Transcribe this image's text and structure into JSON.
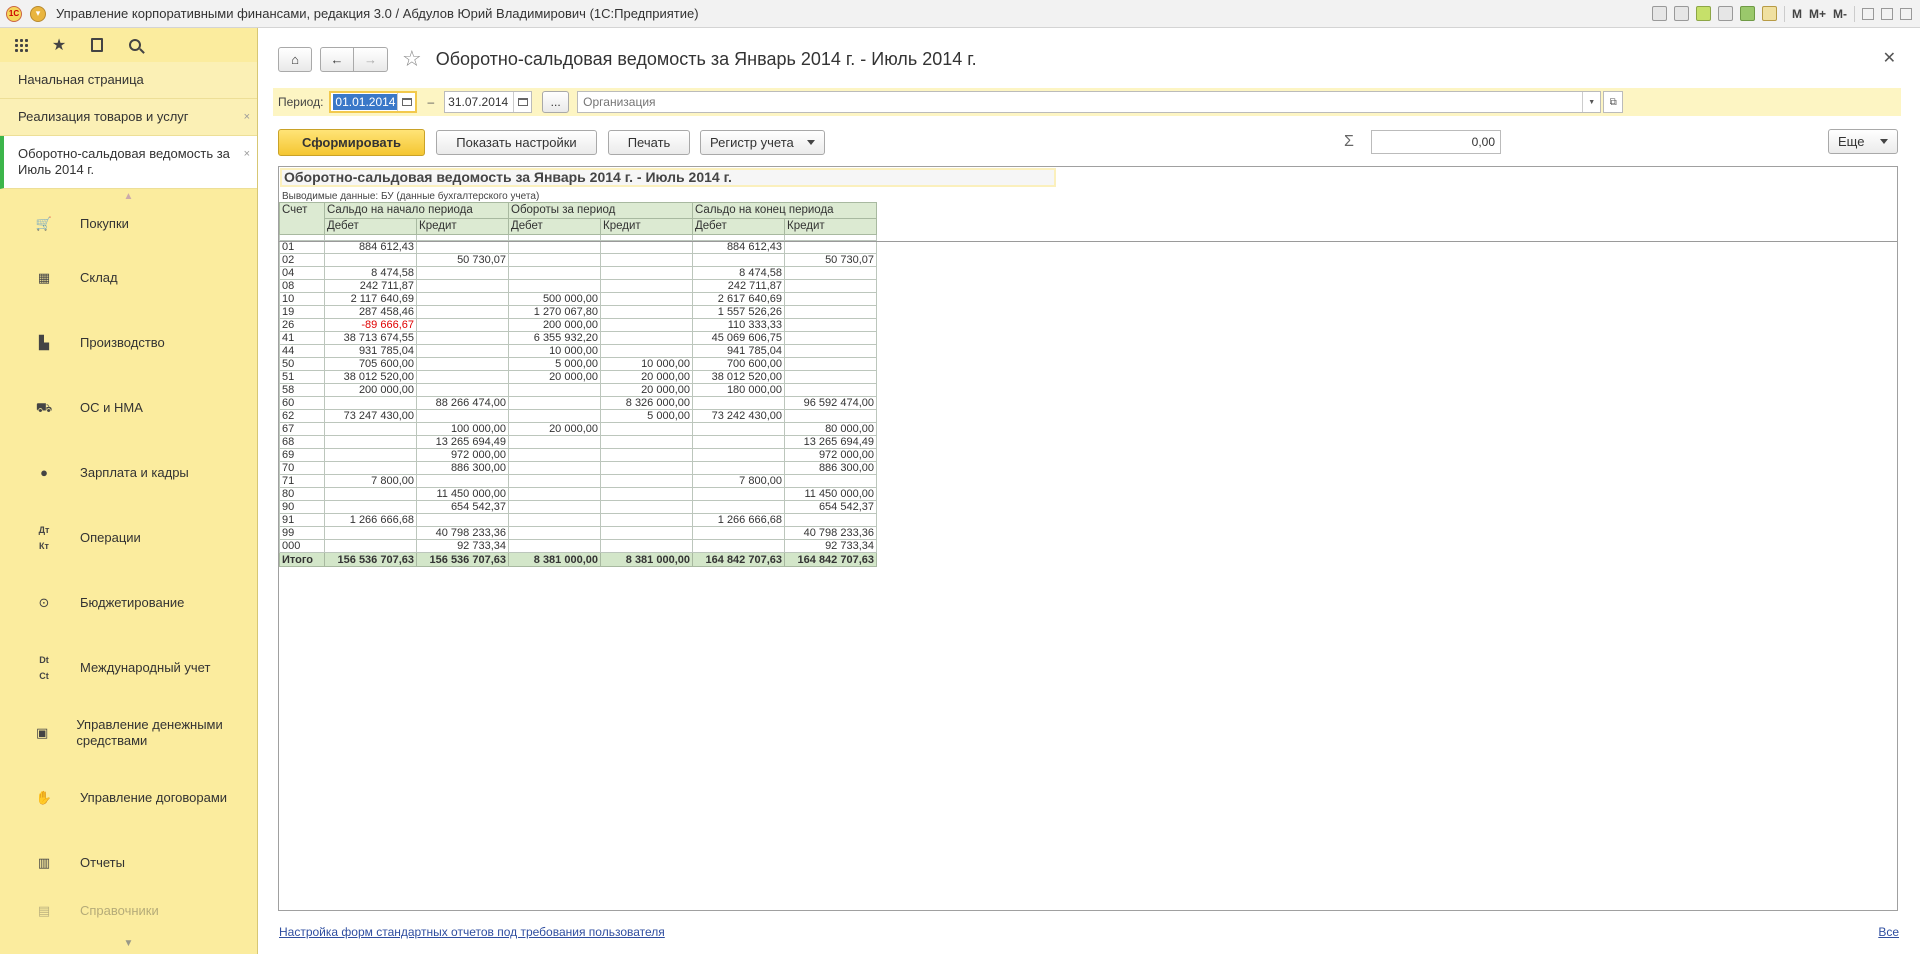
{
  "app": {
    "title": "Управление корпоративными финансами, редакция 3.0 / Абдулов Юрий Владимирович (1С:Предприятие)",
    "logo_label": "1С",
    "tools": {
      "m": "M",
      "m_plus": "M+",
      "m_minus": "M-"
    }
  },
  "sidebar": {
    "open_tabs": [
      {
        "label": "Начальная страница"
      },
      {
        "label": "Реализация товаров и услуг"
      },
      {
        "label": "Оборотно-сальдовая ведомость за Июль 2014 г."
      }
    ],
    "sections": [
      {
        "label": "Покупки",
        "icon": "cart-icon"
      },
      {
        "label": "Склад",
        "icon": "warehouse-icon"
      },
      {
        "label": "Производство",
        "icon": "factory-icon"
      },
      {
        "label": "ОС и НМА",
        "icon": "truck-icon"
      },
      {
        "label": "Зарплата и кадры",
        "icon": "person-icon"
      },
      {
        "label": "Операции",
        "icon": "dt-kt-icon"
      },
      {
        "label": "Бюджетирование",
        "icon": "coins-icon"
      },
      {
        "label": "Международный учет",
        "icon": "dt-ct-icon"
      },
      {
        "label": "Управление денежными средствами",
        "icon": "cash-icon"
      },
      {
        "label": "Управление договорами",
        "icon": "handshake-icon"
      },
      {
        "label": "Отчеты",
        "icon": "bar-chart-icon"
      },
      {
        "label": "Справочники",
        "icon": "book-icon"
      }
    ]
  },
  "form": {
    "title": "Оборотно-сальдовая ведомость за Январь 2014 г. - Июль 2014 г.",
    "period_label": "Период:",
    "date_from": "01.01.2014",
    "date_sep": "–",
    "date_to": "31.07.2014",
    "more_label": "...",
    "org_placeholder": "Организация",
    "generate_label": "Сформировать",
    "settings_label": "Показать настройки",
    "print_label": "Печать",
    "register_label": "Регистр учета",
    "sigma": "Σ",
    "sum_value": "0,00",
    "more_actions_label": "Еще",
    "footer_link": "Настройка форм стандартных отчетов под требования пользователя",
    "footer_all": "Все"
  },
  "report": {
    "title": "Оборотно-сальдовая ведомость за Январь 2014 г. - Июль 2014 г.",
    "subtitle": "Выводимые данные:  БУ (данные бухгалтерского учета)",
    "headers": {
      "account": "Счет",
      "opening": "Сальдо на начало периода",
      "turnover": "Обороты за период",
      "closing": "Сальдо на конец периода",
      "debit": "Дебет",
      "credit": "Кредит"
    },
    "rows": [
      {
        "acc": "01",
        "od": "884 612,43",
        "oc": "",
        "td": "",
        "tc": "",
        "cd": "884 612,43",
        "cc": ""
      },
      {
        "acc": "02",
        "od": "",
        "oc": "50 730,07",
        "td": "",
        "tc": "",
        "cd": "",
        "cc": "50 730,07"
      },
      {
        "acc": "04",
        "od": "8 474,58",
        "oc": "",
        "td": "",
        "tc": "",
        "cd": "8 474,58",
        "cc": ""
      },
      {
        "acc": "08",
        "od": "242 711,87",
        "oc": "",
        "td": "",
        "tc": "",
        "cd": "242 711,87",
        "cc": ""
      },
      {
        "acc": "10",
        "od": "2 117 640,69",
        "oc": "",
        "td": "500 000,00",
        "tc": "",
        "cd": "2 617 640,69",
        "cc": ""
      },
      {
        "acc": "19",
        "od": "287 458,46",
        "oc": "",
        "td": "1 270 067,80",
        "tc": "",
        "cd": "1 557 526,26",
        "cc": ""
      },
      {
        "acc": "26",
        "od": "-89 666,67",
        "oc": "",
        "td": "200 000,00",
        "tc": "",
        "cd": "110 333,33",
        "cc": "",
        "neg": true
      },
      {
        "acc": "41",
        "od": "38 713 674,55",
        "oc": "",
        "td": "6 355 932,20",
        "tc": "",
        "cd": "45 069 606,75",
        "cc": ""
      },
      {
        "acc": "44",
        "od": "931 785,04",
        "oc": "",
        "td": "10 000,00",
        "tc": "",
        "cd": "941 785,04",
        "cc": ""
      },
      {
        "acc": "50",
        "od": "705 600,00",
        "oc": "",
        "td": "5 000,00",
        "tc": "10 000,00",
        "cd": "700 600,00",
        "cc": ""
      },
      {
        "acc": "51",
        "od": "38 012 520,00",
        "oc": "",
        "td": "20 000,00",
        "tc": "20 000,00",
        "cd": "38 012 520,00",
        "cc": ""
      },
      {
        "acc": "58",
        "od": "200 000,00",
        "oc": "",
        "td": "",
        "tc": "20 000,00",
        "cd": "180 000,00",
        "cc": ""
      },
      {
        "acc": "60",
        "od": "",
        "oc": "88 266 474,00",
        "td": "",
        "tc": "8 326 000,00",
        "cd": "",
        "cc": "96 592 474,00"
      },
      {
        "acc": "62",
        "od": "73 247 430,00",
        "oc": "",
        "td": "",
        "tc": "5 000,00",
        "cd": "73 242 430,00",
        "cc": ""
      },
      {
        "acc": "67",
        "od": "",
        "oc": "100 000,00",
        "td": "20 000,00",
        "tc": "",
        "cd": "",
        "cc": "80 000,00"
      },
      {
        "acc": "68",
        "od": "",
        "oc": "13 265 694,49",
        "td": "",
        "tc": "",
        "cd": "",
        "cc": "13 265 694,49"
      },
      {
        "acc": "69",
        "od": "",
        "oc": "972 000,00",
        "td": "",
        "tc": "",
        "cd": "",
        "cc": "972 000,00"
      },
      {
        "acc": "70",
        "od": "",
        "oc": "886 300,00",
        "td": "",
        "tc": "",
        "cd": "",
        "cc": "886 300,00"
      },
      {
        "acc": "71",
        "od": "7 800,00",
        "oc": "",
        "td": "",
        "tc": "",
        "cd": "7 800,00",
        "cc": ""
      },
      {
        "acc": "80",
        "od": "",
        "oc": "11 450 000,00",
        "td": "",
        "tc": "",
        "cd": "",
        "cc": "11 450 000,00"
      },
      {
        "acc": "90",
        "od": "",
        "oc": "654 542,37",
        "td": "",
        "tc": "",
        "cd": "",
        "cc": "654 542,37"
      },
      {
        "acc": "91",
        "od": "1 266 666,68",
        "oc": "",
        "td": "",
        "tc": "",
        "cd": "1 266 666,68",
        "cc": ""
      },
      {
        "acc": "99",
        "od": "",
        "oc": "40 798 233,36",
        "td": "",
        "tc": "",
        "cd": "",
        "cc": "40 798 233,36"
      },
      {
        "acc": "000",
        "od": "",
        "oc": "92 733,34",
        "td": "",
        "tc": "",
        "cd": "",
        "cc": "92 733,34"
      }
    ],
    "total": {
      "acc": "Итого",
      "od": "156 536 707,63",
      "oc": "156 536 707,63",
      "td": "8 381 000,00",
      "tc": "8 381 000,00",
      "cd": "164 842 707,63",
      "cc": "164 842 707,63"
    }
  },
  "colors": {
    "sidebar_bg": "#fbec9e",
    "accent_button": "#f4c632",
    "table_header": "#dcead2",
    "negative": "#e00000",
    "active_tab_marker": "#3cb54a"
  }
}
